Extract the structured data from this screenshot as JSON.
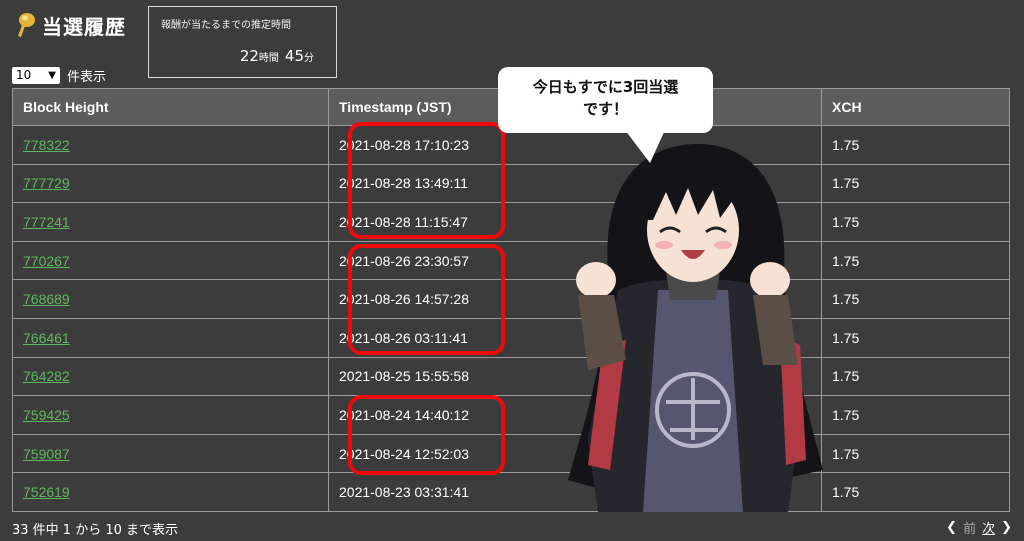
{
  "header": {
    "title": "当選履歴"
  },
  "estimate": {
    "label": "報酬が当たるまでの推定時間",
    "hours": "22",
    "hours_unit": "時間",
    "minutes": "45",
    "minutes_unit": "分"
  },
  "pagesize": {
    "selected": "10",
    "suffix": "件表示"
  },
  "table": {
    "columns": [
      "Block Height",
      "Timestamp (JST)",
      "XCH"
    ],
    "rows": [
      {
        "height": "778322",
        "timestamp": "2021-08-28 17:10:23",
        "xch": "1.75"
      },
      {
        "height": "777729",
        "timestamp": "2021-08-28 13:49:11",
        "xch": "1.75"
      },
      {
        "height": "777241",
        "timestamp": "2021-08-28 11:15:47",
        "xch": "1.75"
      },
      {
        "height": "770267",
        "timestamp": "2021-08-26 23:30:57",
        "xch": "1.75"
      },
      {
        "height": "768689",
        "timestamp": "2021-08-26 14:57:28",
        "xch": "1.75"
      },
      {
        "height": "766461",
        "timestamp": "2021-08-26 03:11:41",
        "xch": "1.75"
      },
      {
        "height": "764282",
        "timestamp": "2021-08-25 15:55:58",
        "xch": "1.75"
      },
      {
        "height": "759425",
        "timestamp": "2021-08-24 14:40:12",
        "xch": "1.75"
      },
      {
        "height": "759087",
        "timestamp": "2021-08-24 12:52:03",
        "xch": "1.75"
      },
      {
        "height": "752619",
        "timestamp": "2021-08-23 03:31:41",
        "xch": "1.75"
      }
    ]
  },
  "footer": {
    "info": "33 件中 1 から 10 まで表示",
    "prev": "前",
    "next": "次"
  },
  "bubble": {
    "line1": "今日もすでに3回当選",
    "line2": "です！"
  },
  "colors": {
    "background": "#3c3c3c",
    "link": "#5fb85f",
    "highlight": "#ee0a0a"
  }
}
